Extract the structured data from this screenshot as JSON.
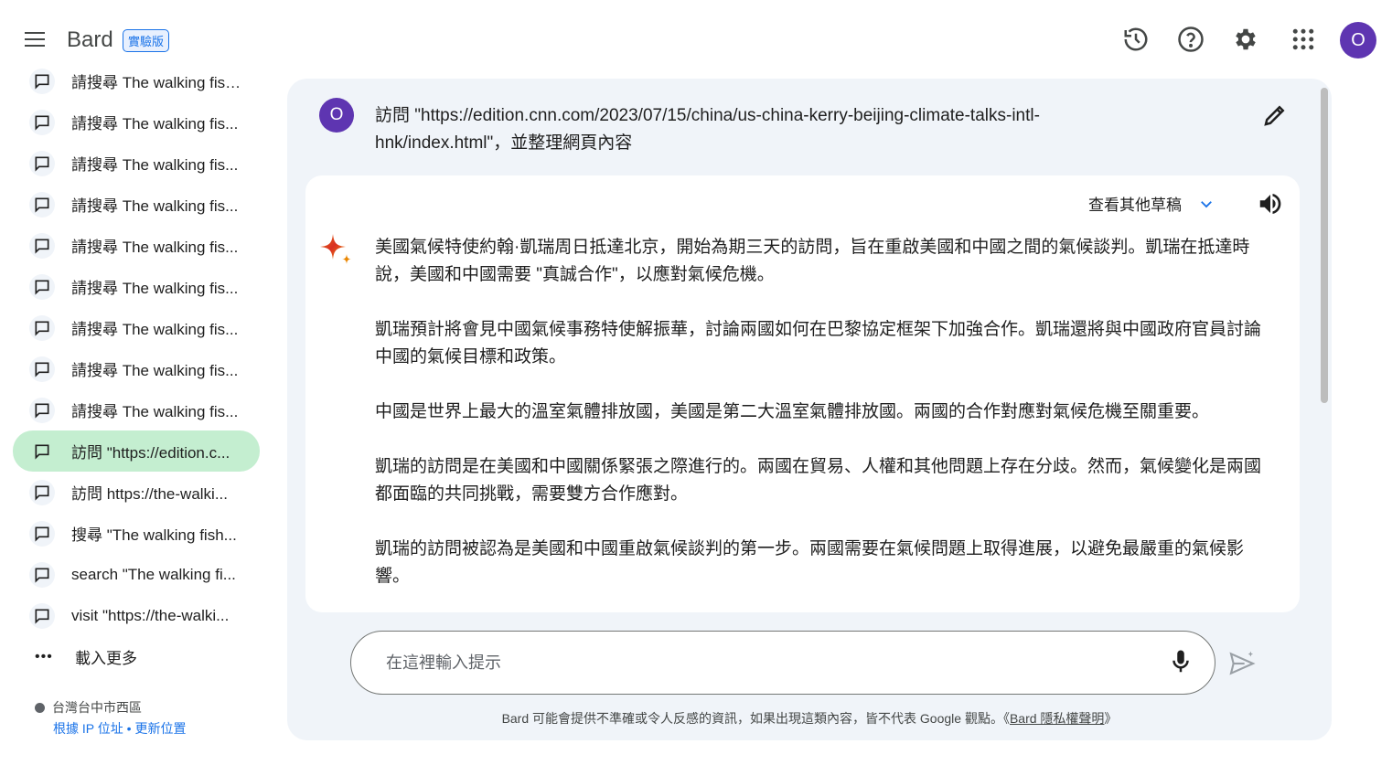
{
  "header": {
    "brand": "Bard",
    "badge": "實驗版",
    "avatar_letter": "O",
    "icons": [
      "history-icon",
      "help-icon",
      "settings-icon",
      "apps-grid-icon"
    ],
    "accent_color": "#1a73e8",
    "avatar_color": "#5e35b1"
  },
  "sidebar": {
    "items": [
      {
        "label": "請搜尋 The walking fish..."
      },
      {
        "label": "請搜尋 The walking fis..."
      },
      {
        "label": "請搜尋 The walking fis..."
      },
      {
        "label": "請搜尋 The walking fis..."
      },
      {
        "label": "請搜尋 The walking fis..."
      },
      {
        "label": "請搜尋 The walking fis..."
      },
      {
        "label": "請搜尋 The walking fis..."
      },
      {
        "label": "請搜尋 The walking fis..."
      },
      {
        "label": "請搜尋 The walking fis..."
      },
      {
        "label": "訪問 \"https://edition.c..."
      },
      {
        "label": "訪問 https://the-walki..."
      },
      {
        "label": "搜尋 \"The walking fish..."
      },
      {
        "label": "search \"The walking fi..."
      },
      {
        "label": "visit \"https://the-walki..."
      }
    ],
    "active_index": 9,
    "active_color": "#c4eed0",
    "load_more": "載入更多",
    "location": "台灣台中市西區",
    "location_link_ip": "根據 IP 位址",
    "location_sep": " • ",
    "location_link_update": "更新位置"
  },
  "conversation": {
    "query_avatar": "O",
    "query": "訪問 \"https://edition.cnn.com/2023/07/15/china/us-china-kerry-beijing-climate-talks-intl-hnk/index.html\"，並整理網頁內容",
    "drafts_label": "查看其他草稿",
    "paragraphs": [
      "美國氣候特使約翰·凱瑞周日抵達北京，開始為期三天的訪問，旨在重啟美國和中國之間的氣候談判。凱瑞在抵達時說，美國和中國需要 \"真誠合作\"，以應對氣候危機。",
      "凱瑞預計將會見中國氣候事務特使解振華，討論兩國如何在巴黎協定框架下加強合作。凱瑞還將與中國政府官員討論中國的氣候目標和政策。",
      "中國是世界上最大的溫室氣體排放國，美國是第二大溫室氣體排放國。兩國的合作對應對氣候危機至關重要。",
      "凱瑞的訪問是在美國和中國關係緊張之際進行的。兩國在貿易、人權和其他問題上存在分歧。然而，氣候變化是兩國都面臨的共同挑戰，需要雙方合作應對。",
      "凱瑞的訪問被認為是美國和中國重啟氣候談判的第一步。兩國需要在氣候問題上取得進展，以避免最嚴重的氣候影響。"
    ]
  },
  "composer": {
    "placeholder": "在這裡輸入提示",
    "disclaimer_text": "Bard 可能會提供不準確或令人反感的資訊，如果出現這類內容，皆不代表 Google 觀點。《",
    "disclaimer_link": "Bard 隱私權聲明",
    "disclaimer_end": "》"
  }
}
